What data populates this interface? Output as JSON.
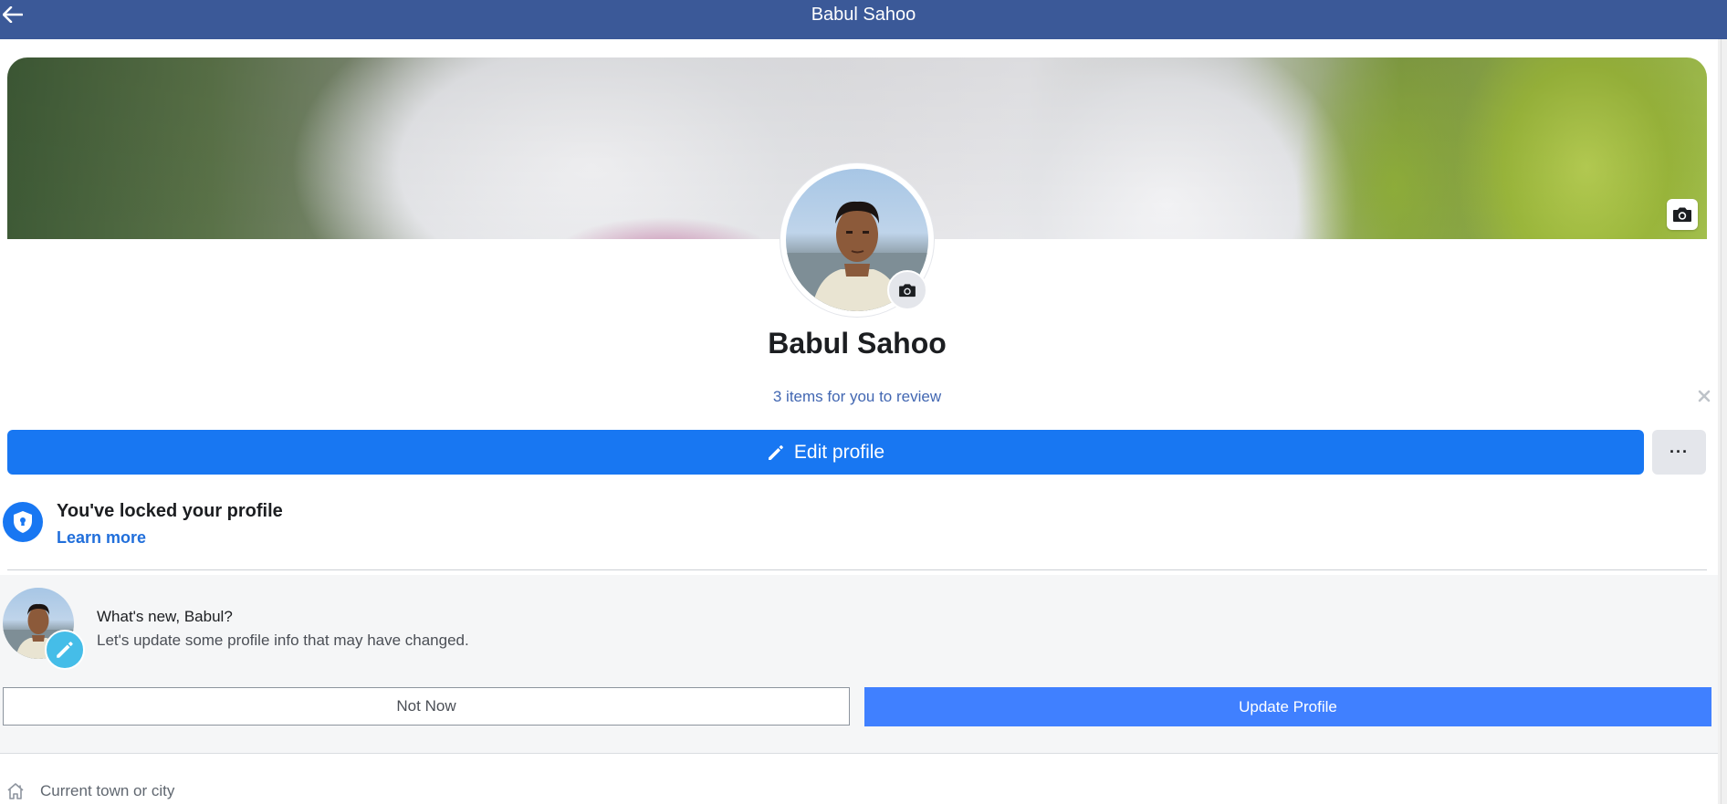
{
  "header": {
    "title": "Babul Sahoo",
    "back_icon": "arrow-left-icon"
  },
  "cover": {
    "camera_icon": "camera-icon"
  },
  "profile": {
    "name": "Babul Sahoo",
    "review_text": "3 items for you to review",
    "close_icon": "close-icon",
    "edit_label": "Edit profile",
    "edit_icon": "pencil-icon",
    "more_label": "···"
  },
  "lock_notice": {
    "title": "You've locked your profile",
    "learn_more": "Learn more",
    "icon": "shield-lock-icon"
  },
  "update_prompt": {
    "title": "What's new, Babul?",
    "subtitle": "Let's update some profile info that may have changed.",
    "not_now_label": "Not Now",
    "update_label": "Update Profile"
  },
  "details": {
    "town_label": "Current town or city",
    "town_icon": "home-icon"
  },
  "colors": {
    "topbar": "#3b5998",
    "primary": "#1877f2",
    "update_button": "#4080ff",
    "link": "#4267b2"
  }
}
